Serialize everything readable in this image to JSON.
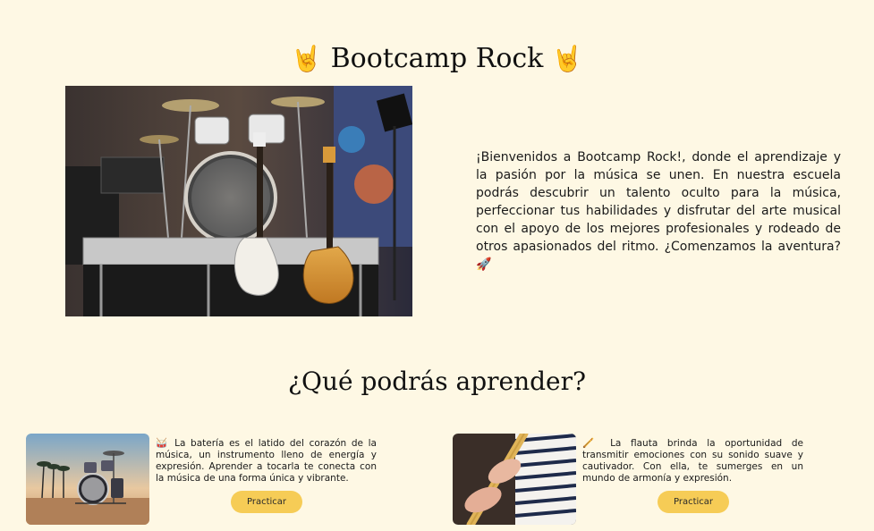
{
  "header": {
    "emoji_left": "🤘",
    "title": "Bootcamp Rock",
    "emoji_right": "🤘"
  },
  "hero": {
    "image_label": "stage-with-drums-and-guitars",
    "text": "¡Bienvenidos a Bootcamp Rock!, donde el aprendizaje y la pasión por la música se unen. En nuestra escuela podrás descubrir un talento oculto para la música, perfeccionar tus habilidades y disfrutar del arte musical con el apoyo de los mejores profesionales y rodeado de otros apasionados del ritmo. ¿Comenzamos la aventura? 🚀"
  },
  "section": {
    "title": "¿Qué podrás aprender?"
  },
  "cards": [
    {
      "image_label": "drum-kit-on-beach",
      "text": "🥁 La batería es el latido del corazón de la música, un instrumento lleno de energía y expresión. Aprender a tocarla te conecta con la música de una forma única y vibrante.",
      "button": "Practicar"
    },
    {
      "image_label": "person-playing-flute",
      "text": "🪈 La flauta brinda la oportunidad de transmitir emociones con su sonido suave y cautivador. Con ella, te sumerges en un mundo de armonía y expresión.",
      "button": "Practicar"
    }
  ],
  "colors": {
    "background": "#fef8e4",
    "button": "#f6cc56",
    "text": "#1a1a1a"
  }
}
